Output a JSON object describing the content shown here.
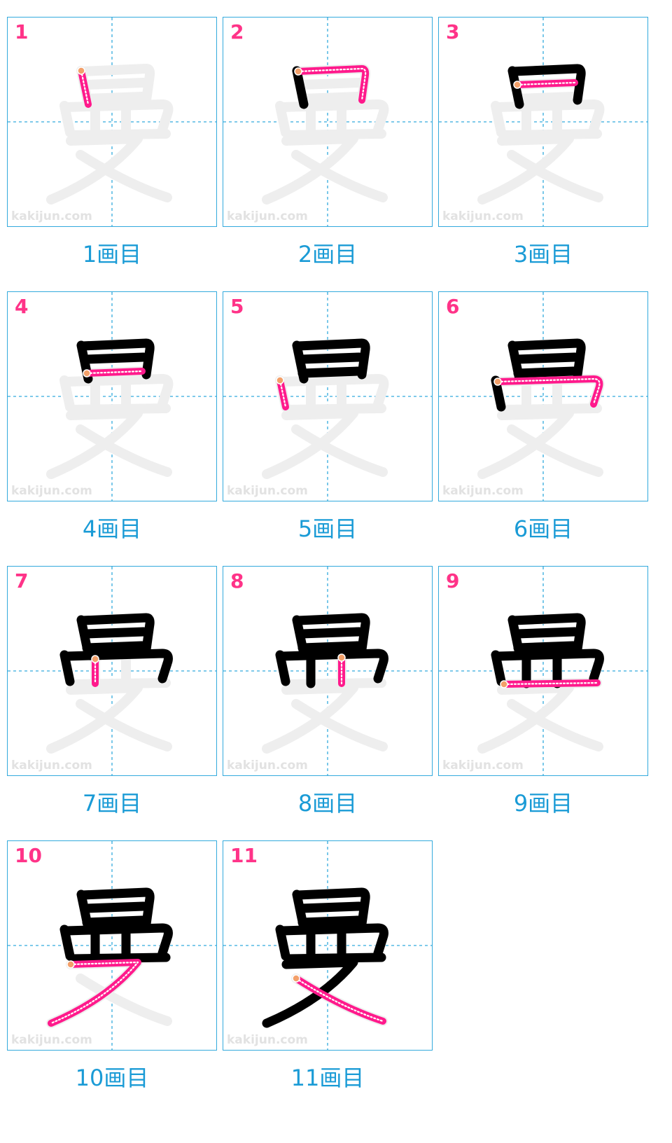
{
  "watermark": "kakijun.com",
  "colors": {
    "grid_border": "#33aadd",
    "stroke_done": "#000000",
    "stroke_current": "#ff1a8c",
    "stroke_ghost": "#eeeeee",
    "step_number": "#ff3388",
    "caption": "#1a9bd6"
  },
  "steps": [
    {
      "number": "1",
      "caption": "1画目"
    },
    {
      "number": "2",
      "caption": "2画目"
    },
    {
      "number": "3",
      "caption": "3画目"
    },
    {
      "number": "4",
      "caption": "4画目"
    },
    {
      "number": "5",
      "caption": "5画目"
    },
    {
      "number": "6",
      "caption": "6画目"
    },
    {
      "number": "7",
      "caption": "7画目"
    },
    {
      "number": "8",
      "caption": "8画目"
    },
    {
      "number": "9",
      "caption": "9画目"
    },
    {
      "number": "10",
      "caption": "10画目"
    },
    {
      "number": "11",
      "caption": "11画目"
    }
  ]
}
